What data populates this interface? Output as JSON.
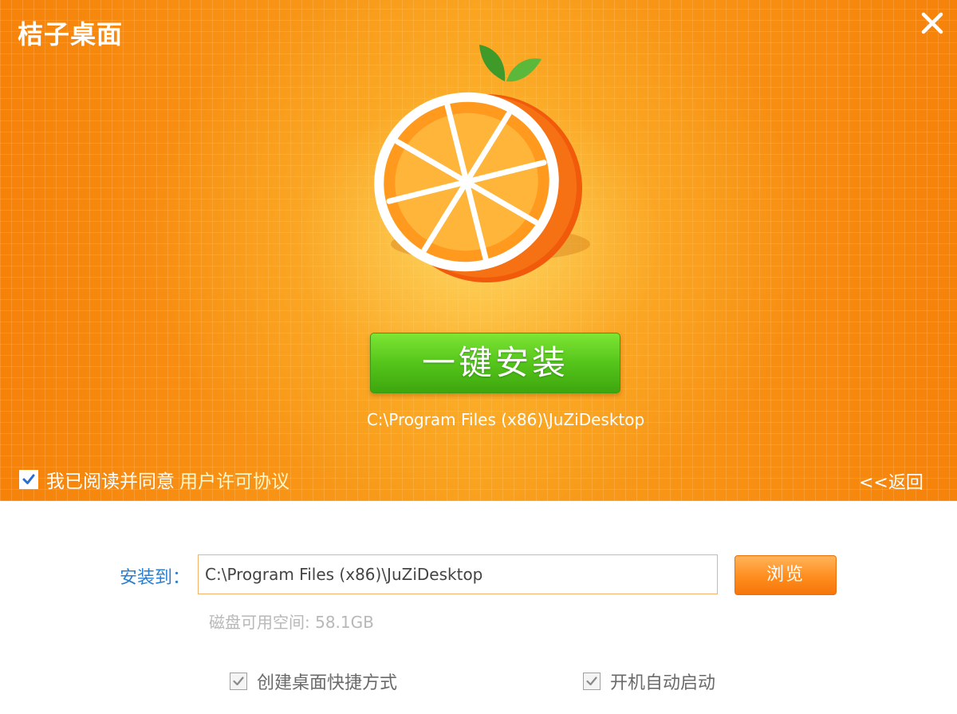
{
  "window": {
    "title": "桔子桌面",
    "close_icon": "close-icon"
  },
  "header": {
    "logo_icon": "orange-logo-icon",
    "install_button_label": "一键安装",
    "install_path": "C:\\Program Files (x86)\\JuZiDesktop",
    "agree": {
      "checked": true,
      "text": "我已阅读并同意",
      "link": "用户许可协议"
    },
    "back_label": "<<返回"
  },
  "settings": {
    "install_to_label": "安装到：",
    "path_value": "C:\\Program Files (x86)\\JuZiDesktop",
    "browse_label": "浏览",
    "disk_space": "磁盘可用空间: 58.1GB",
    "options": [
      {
        "label": "创建桌面快捷方式",
        "checked": true
      },
      {
        "label": "开机自动启动",
        "checked": true
      }
    ]
  },
  "colors": {
    "header_orange": "#f7920f",
    "install_green": "#55c51b",
    "browse_orange": "#ff8d1e",
    "label_blue": "#2a7fd2"
  }
}
